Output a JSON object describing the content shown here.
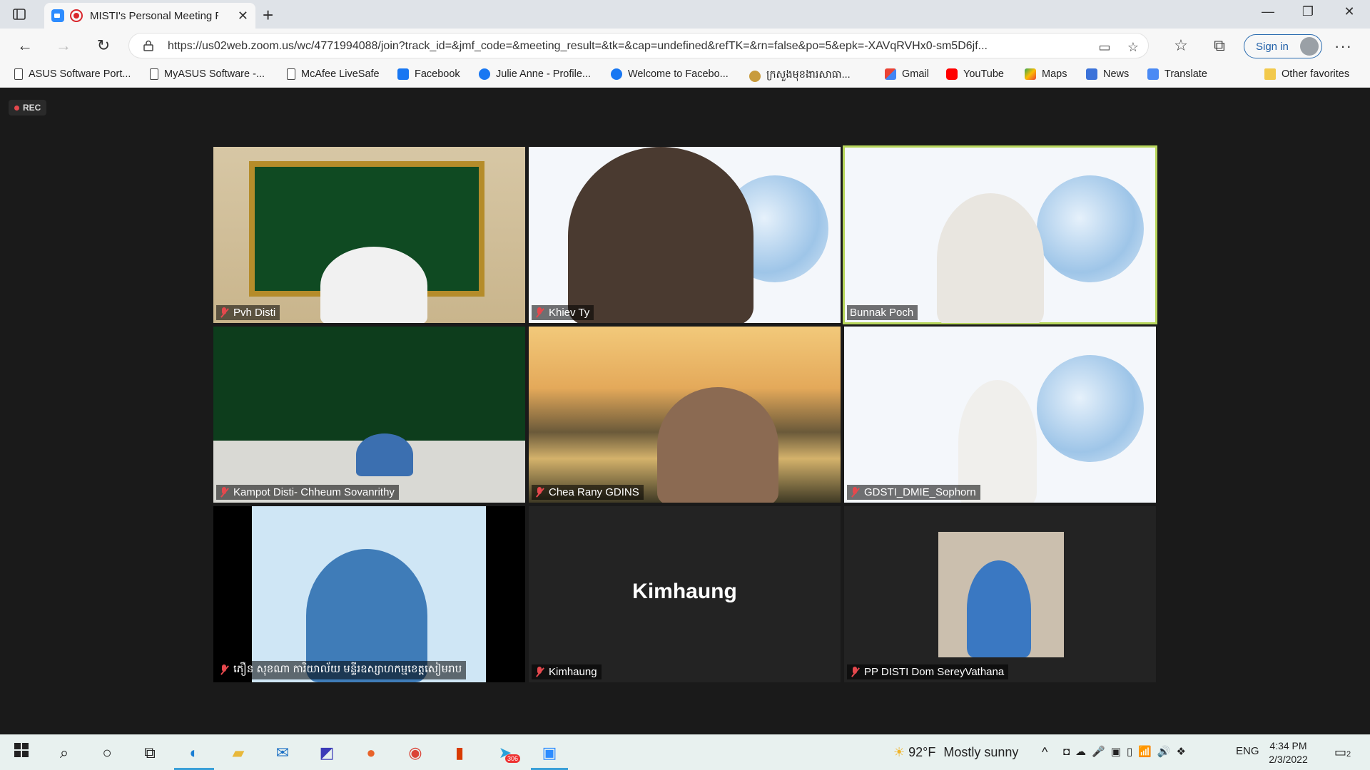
{
  "browser": {
    "tab_title": "MISTI's Personal Meeting Ro",
    "url": "https://us02web.zoom.us/wc/4771994088/join?track_id=&jmf_code=&meeting_result=&tk=&cap=undefined&refTK=&rn=false&po=5&epk=-XAVqRVHx0-sm5D6jf...",
    "sign_in_label": "Sign in",
    "bookmarks": [
      {
        "label": "ASUS Software Port...",
        "icon": "document-icon"
      },
      {
        "label": "MyASUS Software -...",
        "icon": "document-icon"
      },
      {
        "label": "McAfee LiveSafe",
        "icon": "document-icon"
      },
      {
        "label": "Facebook",
        "icon": "facebook-icon"
      },
      {
        "label": "Julie Anne - Profile...",
        "icon": "facebook-icon"
      },
      {
        "label": "Welcome to Facebo...",
        "icon": "facebook-icon"
      },
      {
        "label": "ក្រសួងមុខងារសាធា...",
        "icon": "seal-icon"
      },
      {
        "label": "Gmail",
        "icon": "gmail-icon"
      },
      {
        "label": "YouTube",
        "icon": "youtube-icon"
      },
      {
        "label": "Maps",
        "icon": "maps-icon"
      },
      {
        "label": "News",
        "icon": "news-icon"
      },
      {
        "label": "Translate",
        "icon": "translate-icon"
      }
    ],
    "other_favorites": "Other favorites"
  },
  "meeting": {
    "rec_label": "REC",
    "participants": [
      {
        "name": "Pvh Disti",
        "muted": true,
        "active": false
      },
      {
        "name": "Khiev Ty",
        "muted": true,
        "active": false
      },
      {
        "name": "Bunnak Poch",
        "muted": false,
        "active": true
      },
      {
        "name": "Kampot Disti- Chheum Sovanrithy",
        "muted": true,
        "active": false
      },
      {
        "name": "Chea Rany GDINS",
        "muted": true,
        "active": false
      },
      {
        "name": "GDSTI_DMIE_Sophorn",
        "muted": true,
        "active": false
      },
      {
        "name": "ភឿន សុខណា ការិយាល័យ មន្ទីរឧស្សាហកម្មខេត្តសៀមរាប",
        "muted": true,
        "active": false
      },
      {
        "name": "Kimhaung",
        "muted": true,
        "active": false,
        "video_off_label": "Kimhaung"
      },
      {
        "name": "PP DISTI Dom SereyVathana",
        "muted": true,
        "active": false
      }
    ]
  },
  "taskbar": {
    "weather_temp": "92°F",
    "weather_text": "Mostly sunny",
    "language": "ENG",
    "time": "4:34 PM",
    "date": "2/3/2022",
    "telegram_badge": "306",
    "notification_count": "2"
  },
  "colors": {
    "active_speaker_border": "#b7d65b",
    "muted_icon": "#e5484d",
    "zoom_blue": "#2d8cff"
  }
}
